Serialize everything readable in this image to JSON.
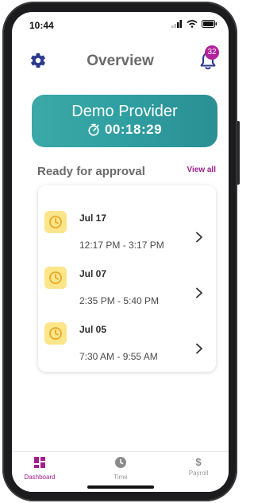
{
  "status_bar": {
    "time": "10:44"
  },
  "header": {
    "title": "Overview",
    "notification_count": "32",
    "gear_icon": "gear-icon",
    "bell_icon": "bell-icon",
    "brand_color": "#2a3a8f",
    "badge_color": "#b3229c"
  },
  "provider": {
    "name": "Demo Provider",
    "timer": "00:18:29",
    "timer_icon": "stopwatch-icon",
    "card_color": "#34a1a3"
  },
  "approvals": {
    "title": "Ready for approval",
    "view_all_label": "View all",
    "items": [
      {
        "date": "Jul 17",
        "range": "12:17 PM - 3:17 PM"
      },
      {
        "date": "Jul 07",
        "range": "2:35 PM - 5:40 PM"
      },
      {
        "date": "Jul 05",
        "range": "7:30 AM - 9:55 AM"
      }
    ]
  },
  "bottom_nav": {
    "items": [
      {
        "label": "Dashboard",
        "icon": "dashboard-icon",
        "active": true
      },
      {
        "label": "Time",
        "icon": "clock-icon",
        "active": false
      },
      {
        "label": "Payroll",
        "icon": "dollar-icon",
        "active": false
      }
    ],
    "active_color": "#a0208e"
  }
}
